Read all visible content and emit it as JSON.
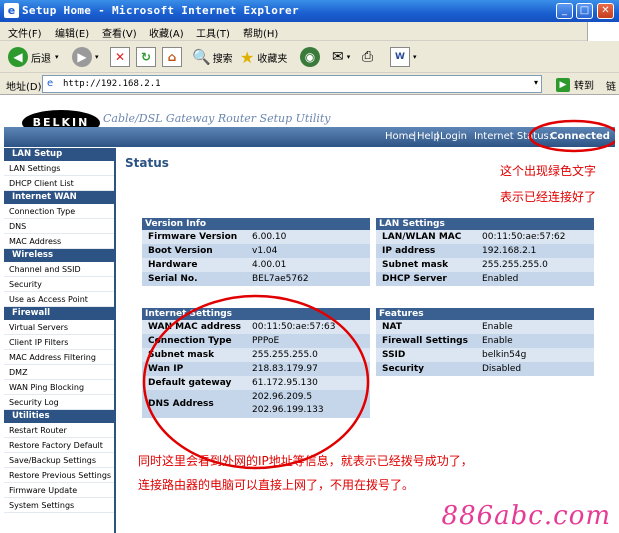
{
  "window": {
    "title": "Setup Home - Microsoft Internet Explorer"
  },
  "menu": [
    "文件(F)",
    "编辑(E)",
    "查看(V)",
    "收藏(A)",
    "工具(T)",
    "帮助(H)"
  ],
  "toolbar": {
    "back": "后退",
    "search": "搜索",
    "favorites": "收藏夹"
  },
  "address": {
    "label": "地址(D)",
    "url": "http://192.168.2.1",
    "go": "转到",
    "links": "链"
  },
  "header": {
    "logo": "BELKIN",
    "subtitle": "Cable/DSL Gateway Router Setup Utility",
    "nav": {
      "home": "Home",
      "help": "Help",
      "login": "Login",
      "status_label": "Internet Status:",
      "status_value": "Connected"
    },
    "status_color": "#2fe02f"
  },
  "sidebar": [
    {
      "section": "LAN Setup",
      "items": [
        "LAN Settings",
        "DHCP Client List"
      ]
    },
    {
      "section": "Internet WAN",
      "items": [
        "Connection Type",
        "DNS",
        "MAC Address"
      ]
    },
    {
      "section": "Wireless",
      "items": [
        "Channel and SSID",
        "Security",
        "Use as Access Point"
      ]
    },
    {
      "section": "Firewall",
      "items": [
        "Virtual Servers",
        "Client IP Filters",
        "MAC Address Filtering",
        "DMZ",
        "WAN Ping Blocking",
        "Security Log"
      ]
    },
    {
      "section": "Utilities",
      "items": [
        "Restart Router",
        "Restore Factory Default",
        "Save/Backup Settings",
        "Restore Previous Settings",
        "Firmware Update",
        "System Settings"
      ]
    }
  ],
  "main": {
    "title": "Status",
    "version_info": {
      "header": "Version Info",
      "rows": [
        {
          "k": "Firmware Version",
          "v": "6.00.10"
        },
        {
          "k": "Boot Version",
          "v": "v1.04"
        },
        {
          "k": "Hardware",
          "v": "4.00.01"
        },
        {
          "k": "Serial No.",
          "v": "BEL7ae5762"
        }
      ]
    },
    "lan_settings": {
      "header": "LAN Settings",
      "rows": [
        {
          "k": "LAN/WLAN MAC",
          "v": "00:11:50:ae:57:62"
        },
        {
          "k": "IP address",
          "v": "192.168.2.1"
        },
        {
          "k": "Subnet mask",
          "v": "255.255.255.0"
        },
        {
          "k": "DHCP Server",
          "v": "Enabled"
        }
      ]
    },
    "internet_settings": {
      "header": "Internet Settings",
      "rows": [
        {
          "k": "WAN MAC address",
          "v": "00:11:50:ae:57:63"
        },
        {
          "k": "Connection Type",
          "v": "PPPoE"
        },
        {
          "k": "Subnet mask",
          "v": "255.255.255.0"
        },
        {
          "k": "Wan IP",
          "v": "218.83.179.97"
        },
        {
          "k": "Default gateway",
          "v": "61.172.95.130"
        }
      ],
      "dns": {
        "k": "DNS Address",
        "v1": "202.96.209.5",
        "v2": "202.96.199.133"
      }
    },
    "features": {
      "header": "Features",
      "rows": [
        {
          "k": "NAT",
          "v": "Enable"
        },
        {
          "k": "Firewall Settings",
          "v": "Enable"
        },
        {
          "k": "SSID",
          "v": "belkin54g"
        },
        {
          "k": "Security",
          "v": "Disabled"
        }
      ]
    }
  },
  "annotations": {
    "top_line1": "这个出现绿色文字",
    "top_line2": "表示已经连接好了",
    "bottom_line1": "同时这里会看到外网的IP地址等信息，就表示已经拨号成功了，",
    "bottom_line2": "连接路由器的电脑可以直接上网了，不用在拨号了。",
    "watermark": "886abc.com",
    "color": "#e00000"
  }
}
